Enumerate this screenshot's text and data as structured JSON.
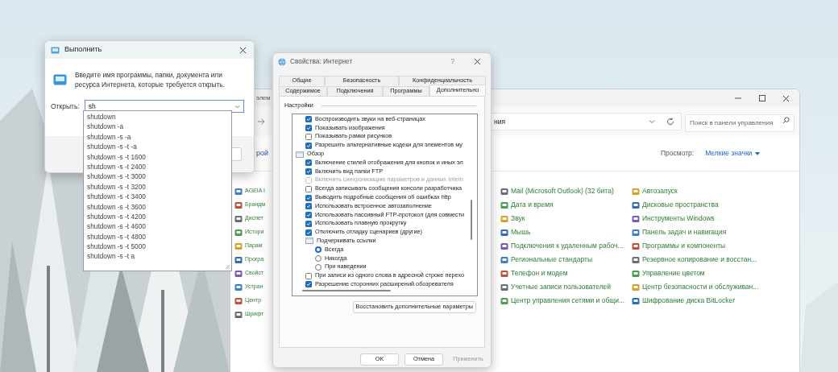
{
  "run_dialog": {
    "title": "Выполнить",
    "prompt": "Введите имя программы, папки, документа или ресурса Интернета, которые требуется открыть.",
    "open_label": "Открыть:",
    "value": "sh",
    "suggestions": [
      "shutdown",
      "shutdown -a",
      "shutdown -s -a",
      "shutdown -s -t -a",
      "shutdown -s -t 1600",
      "shutdown -s -t 2400",
      "shutdown -s -t 3000",
      "shutdown -s -t 3200",
      "shutdown -s -t 3400",
      "shutdown -s -t 3600",
      "shutdown -s -t 4200",
      "shutdown -s -t 4600",
      "shutdown -s -t 4800",
      "shutdown -s -t 5000",
      "shutdown -s -t a"
    ]
  },
  "internet_properties": {
    "title": "Свойства: Интернет",
    "help": "?",
    "tabs_back": [
      {
        "label": "Общие",
        "selected": false
      },
      {
        "label": "Безопасность",
        "selected": false
      },
      {
        "label": "Конфиденциальность",
        "selected": false
      }
    ],
    "tabs_front": [
      {
        "label": "Содержимое",
        "selected": false
      },
      {
        "label": "Подключения",
        "selected": false
      },
      {
        "label": "Программы",
        "selected": false
      },
      {
        "label": "Дополнительно",
        "selected": true
      }
    ],
    "settings_label": "Настройки",
    "settings": [
      {
        "kind": "check",
        "label": "Воспроизводить звуки на веб-страницах",
        "checked": true,
        "disabled": false
      },
      {
        "kind": "check",
        "label": "Показывать изображения",
        "checked": true,
        "disabled": false
      },
      {
        "kind": "check",
        "label": "Показывать рамки рисунков",
        "checked": false,
        "disabled": false
      },
      {
        "kind": "check",
        "label": "Разрешить альтернативные кодеки для элементов му",
        "checked": true,
        "disabled": false
      },
      {
        "kind": "group",
        "label": "Обзор",
        "children": [
          {
            "kind": "check",
            "label": "Включение стилей отображения для кнопок и иных эл",
            "checked": true,
            "disabled": false
          },
          {
            "kind": "check",
            "label": "Включить вид папки FTP",
            "checked": true,
            "disabled": false
          },
          {
            "kind": "check",
            "label": "Включить синхронизацию параметров и данных Intern",
            "checked": false,
            "disabled": true
          },
          {
            "kind": "check",
            "label": "Всегда записывать сообщения консоли разработчика",
            "checked": false,
            "disabled": false
          },
          {
            "kind": "check",
            "label": "Выводить подробные сообщения об ошибках http",
            "checked": true,
            "disabled": false
          },
          {
            "kind": "check",
            "label": "Использовать встроенное автозаполнение",
            "checked": true,
            "disabled": false
          },
          {
            "kind": "check",
            "label": "Использовать пассивный FTP-протокол (для совмести",
            "checked": true,
            "disabled": false
          },
          {
            "kind": "check",
            "label": "Использовать плавную прокрутку",
            "checked": true,
            "disabled": false
          },
          {
            "kind": "check",
            "label": "Отключить отладку сценариев (другие)",
            "checked": true,
            "disabled": false
          },
          {
            "kind": "group",
            "label": "Подчеркивать ссылки",
            "children": [
              {
                "kind": "radio",
                "label": "Всегда",
                "selected": true
              },
              {
                "kind": "radio",
                "label": "Никогда",
                "selected": false
              },
              {
                "kind": "radio",
                "label": "При наведении",
                "selected": false
              }
            ]
          },
          {
            "kind": "check",
            "label": "При записи из одного слова в адресной строке перехо",
            "checked": false,
            "disabled": false
          },
          {
            "kind": "check",
            "label": "Разрешение сторонних расширений обозревателя",
            "checked": true,
            "disabled": false
          }
        ]
      }
    ],
    "reset_button": "Восстановить дополнительные параметры",
    "buttons": [
      {
        "label": "OK",
        "disabled": false
      },
      {
        "label": "Отмена",
        "disabled": false
      },
      {
        "label": "Применить",
        "disabled": true
      }
    ]
  },
  "control_panel": {
    "title": "элем",
    "address": "ния",
    "search": {
      "placeholder": "Поиск в панели управления"
    },
    "heading": "рой",
    "view_label": "Просмотр:",
    "view_value": "Мелкие значки",
    "column_1": [
      "AGEIA I",
      "Брандм",
      "Диспет",
      "Истори",
      "Парам",
      "Програ",
      "Свойст",
      "Устран",
      "Центр",
      "Шрифт"
    ],
    "column_2": [
      "Mail (Microsoft Outlook) (32 бита)",
      "Дата и время",
      "Звук",
      "Мышь",
      "Подключения к удаленным рабоч...",
      "Региональные стандарты",
      "Телефон и модем",
      "Учетные записи пользователей",
      "Центр управления сетями и общи..."
    ],
    "column_3": [
      "Автозапуск",
      "Дисковые пространства",
      "Инструменты Windows",
      "Панель задач и навигация",
      "Программы и компоненты",
      "Резервное копирование и восстан...",
      "Управление цветом",
      "Центр безопасности и обслуживан...",
      "Шифрование диска BitLocker"
    ]
  }
}
